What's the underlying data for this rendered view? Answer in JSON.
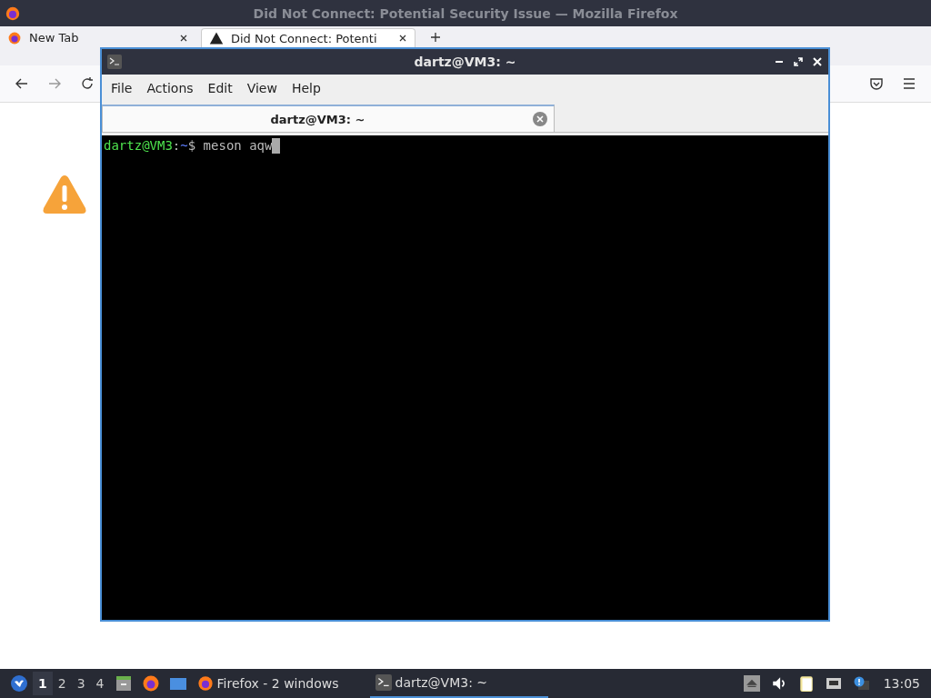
{
  "firefox": {
    "title": "Did Not Connect: Potential Security Issue — Mozilla Firefox",
    "tabs": [
      {
        "label": "New Tab",
        "selected": false,
        "kind": "newtab"
      },
      {
        "label": "Did Not Connect: Potenti",
        "selected": true,
        "kind": "warning"
      }
    ]
  },
  "terminal": {
    "title": "dartz@VM3: ~",
    "menu": [
      "File",
      "Actions",
      "Edit",
      "View",
      "Help"
    ],
    "tabs": [
      {
        "label": "dartz@VM3: ~",
        "selected": true
      }
    ],
    "line": [
      {
        "text": "dartz@VM3",
        "kind": "host"
      },
      {
        "text": ":",
        "kind": "plain"
      },
      {
        "text": "~",
        "kind": "path"
      },
      {
        "text": "$ meson aqw",
        "kind": "plain"
      }
    ]
  },
  "taskbar": {
    "workspaces": [
      {
        "label": "1",
        "selected": true
      },
      {
        "label": "2",
        "selected": false
      },
      {
        "label": "3",
        "selected": false
      },
      {
        "label": "4",
        "selected": false
      }
    ],
    "tasks": [
      {
        "label": "Firefox - 2 windows",
        "selected": false,
        "kind": "firefox"
      },
      {
        "label": "dartz@VM3: ~",
        "selected": true,
        "kind": "terminal"
      }
    ],
    "clock": "13:05"
  }
}
